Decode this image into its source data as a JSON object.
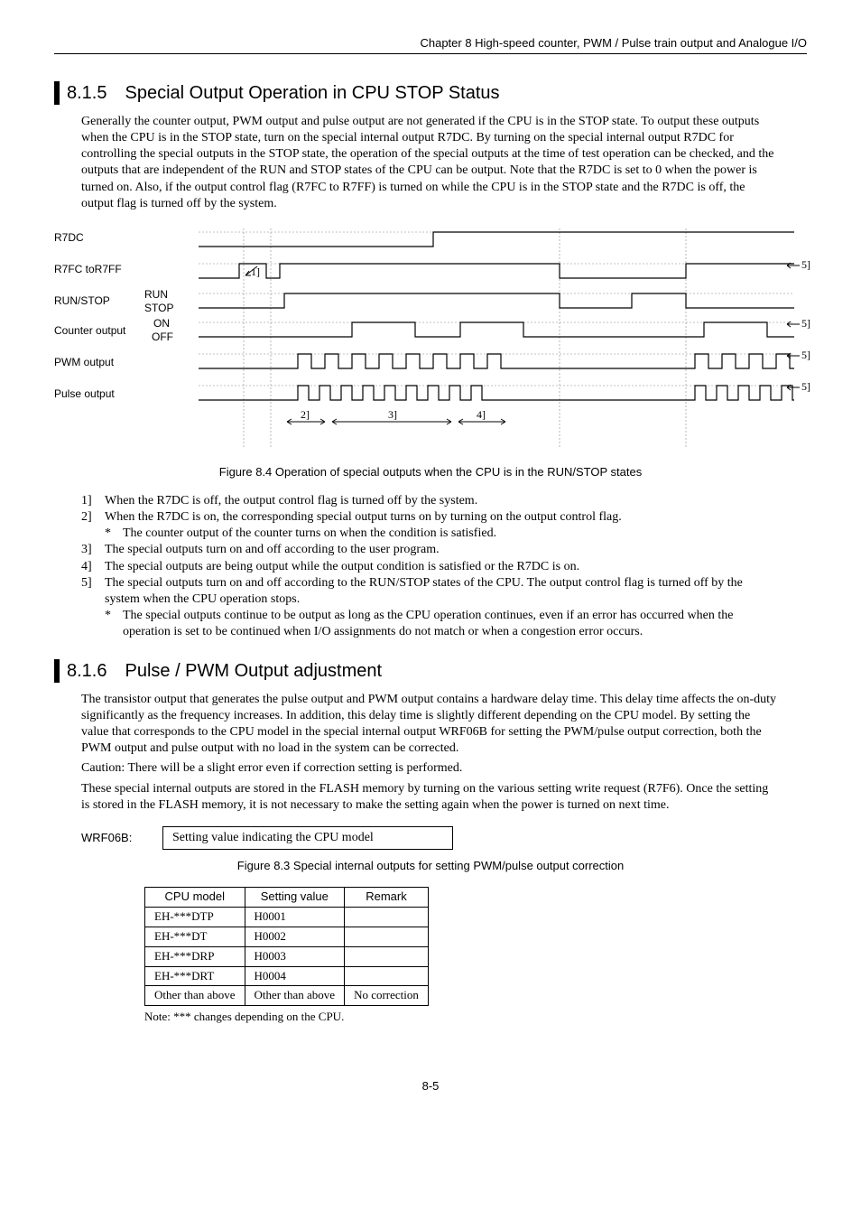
{
  "header": "Chapter 8  High-speed counter, PWM / Pulse train output and Analogue I/O",
  "s1": {
    "num": "8.1.5",
    "title": "Special Output Operation in CPU STOP Status",
    "para": "Generally the counter output, PWM output and pulse output are not generated if the CPU is in the STOP state. To output these outputs when the CPU is in the STOP state, turn on the special internal output R7DC. By turning on the special internal output R7DC for controlling the special outputs in the STOP state, the operation of the special outputs at the time of test operation can be checked, and the outputs that are independent of the RUN and STOP states of the CPU can be output. Note that the R7DC is set to 0 when the power is turned on. Also, if the output control flag (R7FC to R7FF) is turned on while the CPU is in the STOP state and the R7DC is off, the output flag is turned off by the system."
  },
  "diagram": {
    "labels": {
      "r7dc": "R7DC",
      "r7fc": "R7FC toR7FF",
      "runstop": "RUN/STOP",
      "run": "RUN",
      "stop": "STOP",
      "counter": "Counter output",
      "on": "ON",
      "off": "OFF",
      "pwm": "PWM output",
      "pulse": "Pulse output",
      "m1": "1]",
      "m2": "2]",
      "m3": "3]",
      "m4": "4]",
      "m5": "5]"
    },
    "caption": "Figure 8.4 Operation of special outputs when the CPU is in the RUN/STOP states"
  },
  "list1": {
    "i1": "When the R7DC is off, the output control flag is turned off by the system.",
    "i2": "When the R7DC is on, the corresponding special output turns on by turning on the output control flag.",
    "i2star": "The counter output of the counter turns on when the condition is satisfied.",
    "i3": "The special outputs turn on and off according to the user program.",
    "i4": "The special outputs are being output while the output condition is satisfied or the R7DC is on.",
    "i5": "The special outputs turn on and off according to the RUN/STOP states of the CPU. The output control flag is turned off by the system when the CPU operation stops.",
    "i5star": "The special outputs continue to be output as long as the CPU operation continues, even if an error has occurred when the operation is set to be continued when I/O assignments do not match or when a congestion error occurs."
  },
  "s2": {
    "num": "8.1.6",
    "title": "Pulse / PWM Output adjustment",
    "para1": "The transistor output that generates the pulse output and PWM output contains a hardware delay time. This delay time affects the on-duty significantly as the frequency increases. In addition, this delay time is slightly different depending on the CPU model. By setting the value that corresponds to the CPU model in the special internal output WRF06B for setting the PWM/pulse output correction, both the PWM output and pulse output with no load in the system can be corrected.",
    "caution": "Caution:   There will be a slight error even if correction setting is performed.",
    "para2": "These special internal outputs are stored in the FLASH memory by turning on the various setting write request (R7F6). Once the setting is stored in the FLASH memory, it is not necessary to make the setting again when the power is turned on next time."
  },
  "wrf": {
    "label": "WRF06B:",
    "box": "Setting value indicating the CPU model"
  },
  "figcap2": "Figure 8.3 Special internal outputs for setting PWM/pulse output correction",
  "table": {
    "h1": "CPU model",
    "h2": "Setting value",
    "h3": "Remark",
    "r1c1": "EH-***DTP",
    "r1c2": "H0001",
    "r1c3": "",
    "r2c1": "EH-***DT",
    "r2c2": "H0002",
    "r2c3": "",
    "r3c1": "EH-***DRP",
    "r3c2": "H0003",
    "r3c3": "",
    "r4c1": "EH-***DRT",
    "r4c2": "H0004",
    "r4c3": "",
    "r5c1": "Other than above",
    "r5c2": "Other than above",
    "r5c3": "No correction"
  },
  "note": "Note: *** changes depending on the CPU.",
  "pagenum": "8-5",
  "chart_data": {
    "type": "timing_diagram",
    "signals": [
      {
        "name": "R7DC",
        "levels": "low→high (mid) →stays high"
      },
      {
        "name": "R7FC toR7FF",
        "levels": "pulse early (marked 1]), long high mid section, gap, high at end (marked 5])"
      },
      {
        "name": "RUN/STOP",
        "states": [
          "RUN",
          "STOP"
        ],
        "levels": "STOP→RUN long→STOP→RUN short→STOP (last high marked 5])"
      },
      {
        "name": "Counter output",
        "states": [
          "ON",
          "OFF"
        ],
        "levels": "off, two medium pulses mid-region, one pulse at end (marked 5])"
      },
      {
        "name": "PWM output",
        "levels": "burst of ~9 narrow pulses mid-region, burst at end (marked 5])"
      },
      {
        "name": "Pulse output",
        "levels": "burst of ~9 narrow pulses mid-region, burst at end (marked 5])"
      }
    ],
    "bottom_markers": [
      "2]",
      "3]",
      "4]"
    ]
  }
}
